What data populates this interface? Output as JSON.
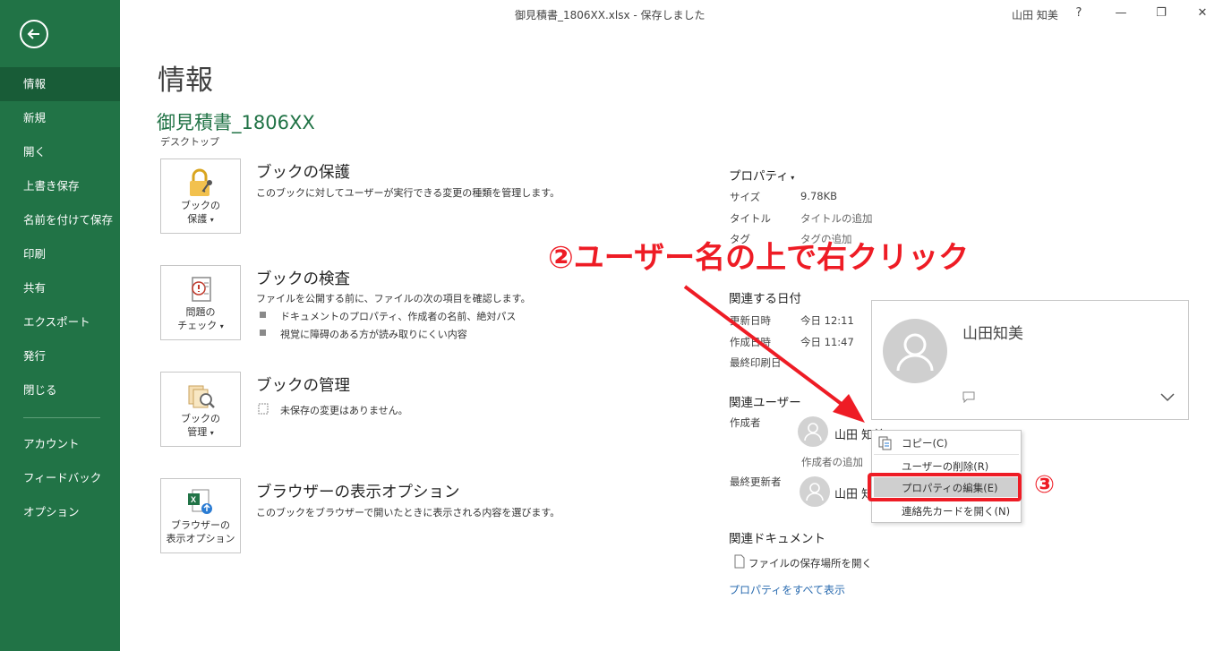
{
  "window": {
    "title": "御見積書_1806XX.xlsx  -  保存しました",
    "user": "山田 知美",
    "help_label": "?",
    "minimize_label": "—",
    "restore_label": "❐",
    "close_label": "✕"
  },
  "sidebar": {
    "items": [
      {
        "label": "情報",
        "active": true
      },
      {
        "label": "新規"
      },
      {
        "label": "開く"
      },
      {
        "label": "上書き保存"
      },
      {
        "label": "名前を付けて保存"
      },
      {
        "label": "印刷"
      },
      {
        "label": "共有"
      },
      {
        "label": "エクスポート"
      },
      {
        "label": "発行"
      },
      {
        "label": "閉じる"
      },
      {
        "label": "アカウント"
      },
      {
        "label": "フィードバック"
      },
      {
        "label": "オプション"
      }
    ],
    "colors": {
      "background": "#217346",
      "active": "#185c37"
    }
  },
  "main": {
    "title": "情報",
    "file_name": "御見積書_1806XX",
    "location": "デスクトップ",
    "cards": [
      {
        "button_line1": "ブックの",
        "button_line2": "保護",
        "heading": "ブックの保護",
        "description": "このブックに対してユーザーが実行できる変更の種類を管理します。",
        "icon": "lock-icon"
      },
      {
        "button_line1": "問題の",
        "button_line2": "チェック",
        "heading": "ブックの検査",
        "description": "ファイルを公開する前に、ファイルの次の項目を確認します。",
        "bullets": [
          "ドキュメントのプロパティ、作成者の名前、絶対パス",
          "視覚に障碍のある方が読み取りにくい内容"
        ],
        "icon": "inspect-icon"
      },
      {
        "button_line1": "ブックの",
        "button_line2": "管理",
        "heading": "ブックの管理",
        "description": "未保存の変更はありません。",
        "icon": "manage-workbook-icon"
      },
      {
        "button_line1": "ブラウザーの",
        "button_line2": "表示オプション",
        "heading": "ブラウザーの表示オプション",
        "description": "このブックをブラウザーで開いたときに表示される内容を選びます。",
        "icon": "browser-view-icon"
      }
    ]
  },
  "properties": {
    "heading": "プロパティ",
    "rows": [
      {
        "label": "サイズ",
        "value": "9.78KB"
      },
      {
        "label": "タイトル",
        "value": "タイトルの追加"
      },
      {
        "label": "タグ",
        "value": "タグの追加"
      }
    ],
    "dates_heading": "関連する日付",
    "dates": [
      {
        "label": "更新日時",
        "value": "今日 12:11"
      },
      {
        "label": "作成日時",
        "value": "今日 11:47"
      },
      {
        "label": "最終印刷日",
        "value": ""
      }
    ],
    "people_heading": "関連ユーザー",
    "author_label": "作成者",
    "author_name": "山田 知美",
    "add_author": "作成者の追加",
    "last_modified_label": "最終更新者",
    "last_modified_name": "山田 知美",
    "docs_heading": "関連ドキュメント",
    "open_location": "ファイルの保存場所を開く",
    "show_all": "プロパティをすべて表示"
  },
  "contact_card": {
    "name": "山田知美"
  },
  "context_menu": {
    "items": [
      {
        "label": "コピー(C)",
        "icon": "copy-icon"
      },
      {
        "label": "ユーザーの削除(R)"
      },
      {
        "label": "プロパティの編集(E)",
        "highlighted": true
      },
      {
        "label": "連絡先カードを開く(N)"
      }
    ]
  },
  "annotations": {
    "step2": "②ユーザー名の上で右クリック",
    "step3": "③",
    "color": "#ee1c25"
  }
}
